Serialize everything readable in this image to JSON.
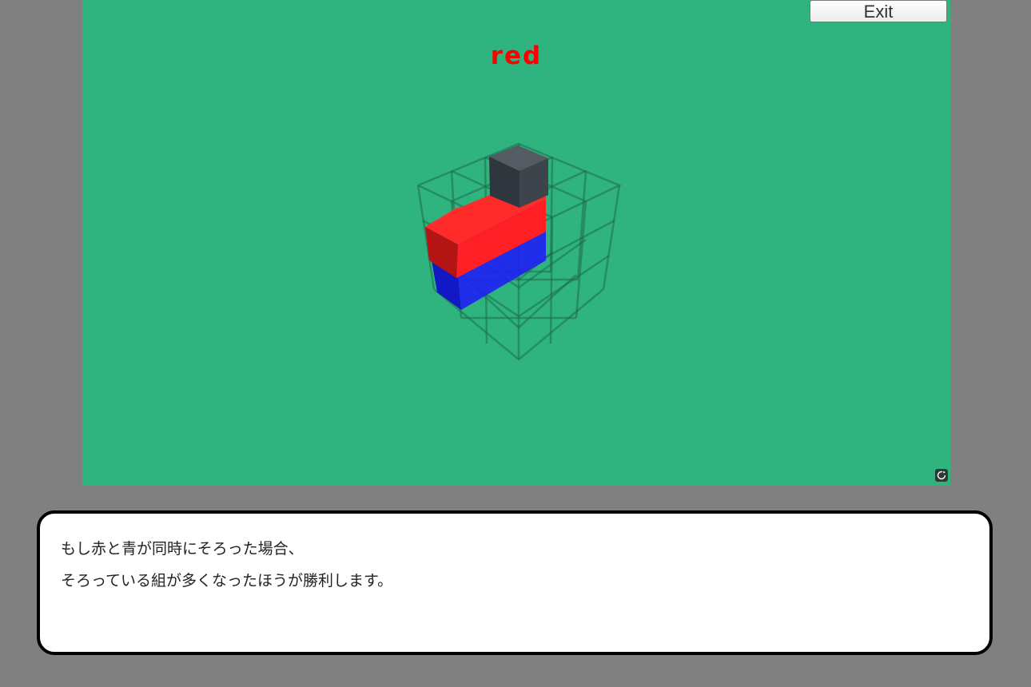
{
  "header": {
    "exit_label": "Exit"
  },
  "game": {
    "turn_label": "red",
    "turn_color": "#ff0000",
    "board_background": "#2fb47f",
    "piece_colors": {
      "red": "#ff1f24",
      "blue": "#1a1aee",
      "dark": "#3e444c"
    },
    "reset_icon": "refresh-icon"
  },
  "dialog": {
    "lines": [
      "もし赤と青が同時にそろった場合、",
      "そろっている組が多くなったほうが勝利します。"
    ]
  }
}
